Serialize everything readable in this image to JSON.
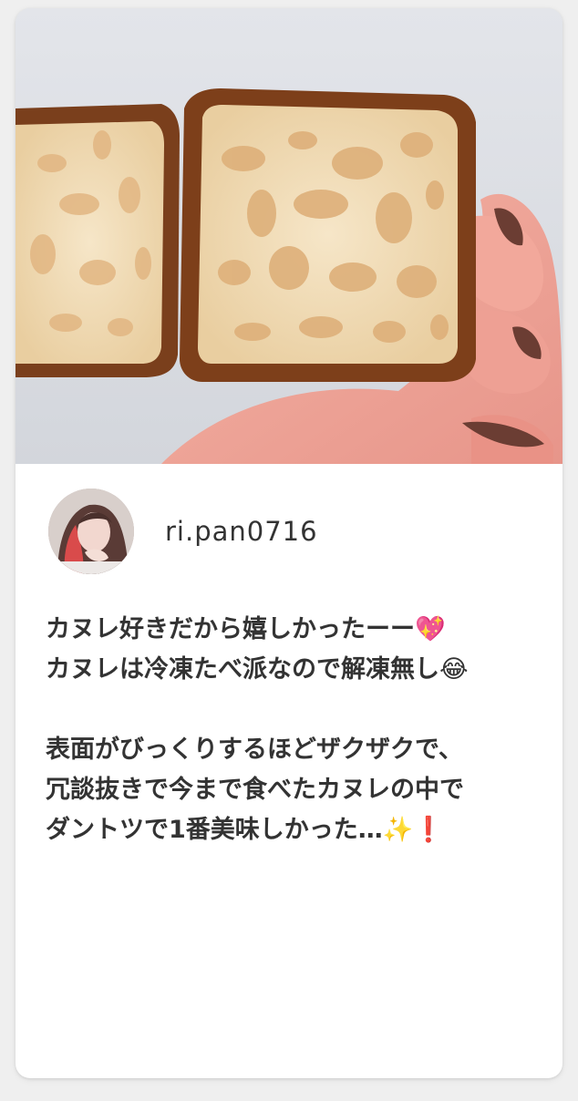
{
  "post": {
    "photo_icon": "canele-bread-photo",
    "author": {
      "avatar_icon": "user-avatar",
      "username": "ri.pan0716"
    },
    "caption_lines": [
      "カヌレ好きだから嬉しかったーー💖",
      "カヌレは冷凍たべ派なので解凍無し😂",
      "",
      "表面がびっくりするほどザクザクで、",
      "冗談抜きで今まで食べたカヌレの中で",
      "ダントツで1番美味しかった…✨❗"
    ]
  }
}
